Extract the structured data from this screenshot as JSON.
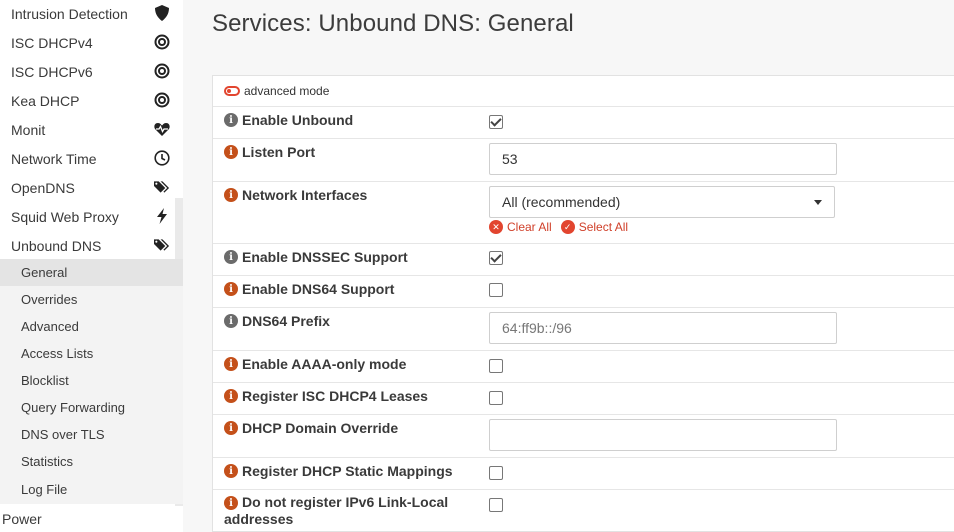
{
  "sidebar": {
    "items": [
      {
        "label": "Intrusion Detection",
        "icon": "shield-icon"
      },
      {
        "label": "ISC DHCPv4",
        "icon": "bullseye-icon"
      },
      {
        "label": "ISC DHCPv6",
        "icon": "bullseye-icon"
      },
      {
        "label": "Kea DHCP",
        "icon": "bullseye-icon"
      },
      {
        "label": "Monit",
        "icon": "heartbeat-icon"
      },
      {
        "label": "Network Time",
        "icon": "clock-icon"
      },
      {
        "label": "OpenDNS",
        "icon": "tags-icon"
      },
      {
        "label": "Squid Web Proxy",
        "icon": "bolt-icon"
      },
      {
        "label": "Unbound DNS",
        "icon": "tags-icon"
      }
    ],
    "subitems": [
      "General",
      "Overrides",
      "Advanced",
      "Access Lists",
      "Blocklist",
      "Query Forwarding",
      "DNS over TLS",
      "Statistics",
      "Log File"
    ],
    "active_subitem": "General",
    "power_label": "Power"
  },
  "page": {
    "title": "Services: Unbound DNS: General"
  },
  "form": {
    "advanced_mode_label": "advanced mode",
    "enable_unbound": {
      "label": "Enable Unbound",
      "checked": true
    },
    "listen_port": {
      "label": "Listen Port",
      "value": "53"
    },
    "network_interfaces": {
      "label": "Network Interfaces",
      "value": "All (recommended)",
      "clear_all": "Clear All",
      "select_all": "Select All"
    },
    "enable_dnssec": {
      "label": "Enable DNSSEC Support",
      "checked": true
    },
    "enable_dns64": {
      "label": "Enable DNS64 Support",
      "checked": false
    },
    "dns64_prefix": {
      "label": "DNS64 Prefix",
      "placeholder": "64:ff9b::/96"
    },
    "aaaa_only": {
      "label": "Enable AAAA-only mode",
      "checked": false
    },
    "register_dhcp4": {
      "label": "Register ISC DHCP4 Leases",
      "checked": false
    },
    "dhcp_domain_override": {
      "label": "DHCP Domain Override",
      "value": ""
    },
    "register_static": {
      "label": "Register DHCP Static Mappings",
      "checked": false
    },
    "ipv6_linklocal": {
      "label": "Do not register IPv6 Link-Local addresses",
      "checked": false
    }
  },
  "colors": {
    "accent": "#e2452f",
    "info_orange": "#c4501a",
    "info_grey": "#6b6b6b"
  }
}
